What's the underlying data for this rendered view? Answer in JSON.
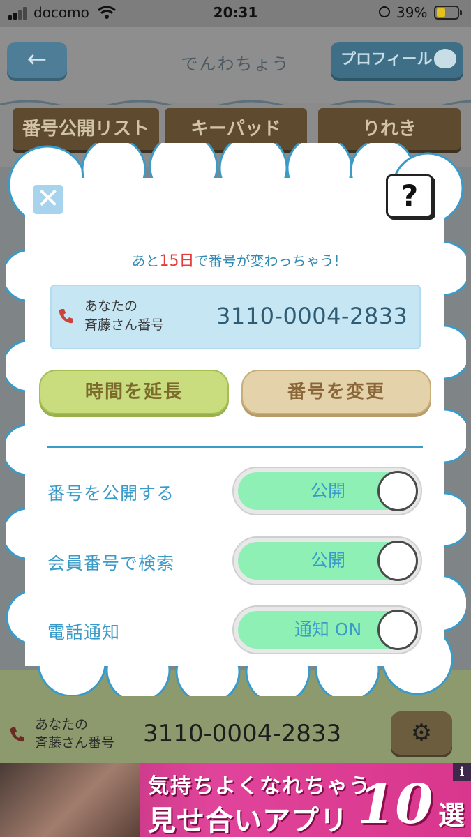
{
  "status_bar": {
    "carrier": "docomo",
    "time": "20:31",
    "battery_percent": "39%",
    "battery_color": "#e6c11a"
  },
  "app": {
    "title": "でんわちょう",
    "back_icon": "←",
    "profile_label": "プロフィール",
    "tabs": [
      {
        "label": "番号公開リスト",
        "icon": "phone-icon"
      },
      {
        "label": "キーパッド",
        "icon": "keypad-icon"
      },
      {
        "label": "りれき",
        "icon": "list-icon"
      }
    ],
    "bottom": {
      "label_line1": "あなたの",
      "label_line2": "斉藤さん番号",
      "number": "3110-0004-2833",
      "settings_icon": "⚙"
    }
  },
  "modal": {
    "close_icon": "✕",
    "help_icon": "?",
    "expiry_prefix": "あと",
    "expiry_days": "15日",
    "expiry_suffix": "で番号が変わっちゃう!",
    "number_label_line1": "あなたの",
    "number_label_line2": "斉藤さん番号",
    "number": "3110-0004-2833",
    "extend_button": "時間を延長",
    "change_button": "番号を変更",
    "settings": [
      {
        "label": "番号を公開する",
        "toggle_text": "公開",
        "on": true
      },
      {
        "label": "会員番号で検索",
        "toggle_text": "公開",
        "on": true
      },
      {
        "label": "電話通知",
        "toggle_text": "通知 ON",
        "on": true
      }
    ],
    "accent_color": "#3a9bc9",
    "toggle_on_color": "#8ff0b5"
  },
  "ad": {
    "line1": "気持ちよくなれちゃう",
    "line2": "見せ合いアプリ",
    "number": "10",
    "suffix": "選",
    "info_icon": "i"
  }
}
